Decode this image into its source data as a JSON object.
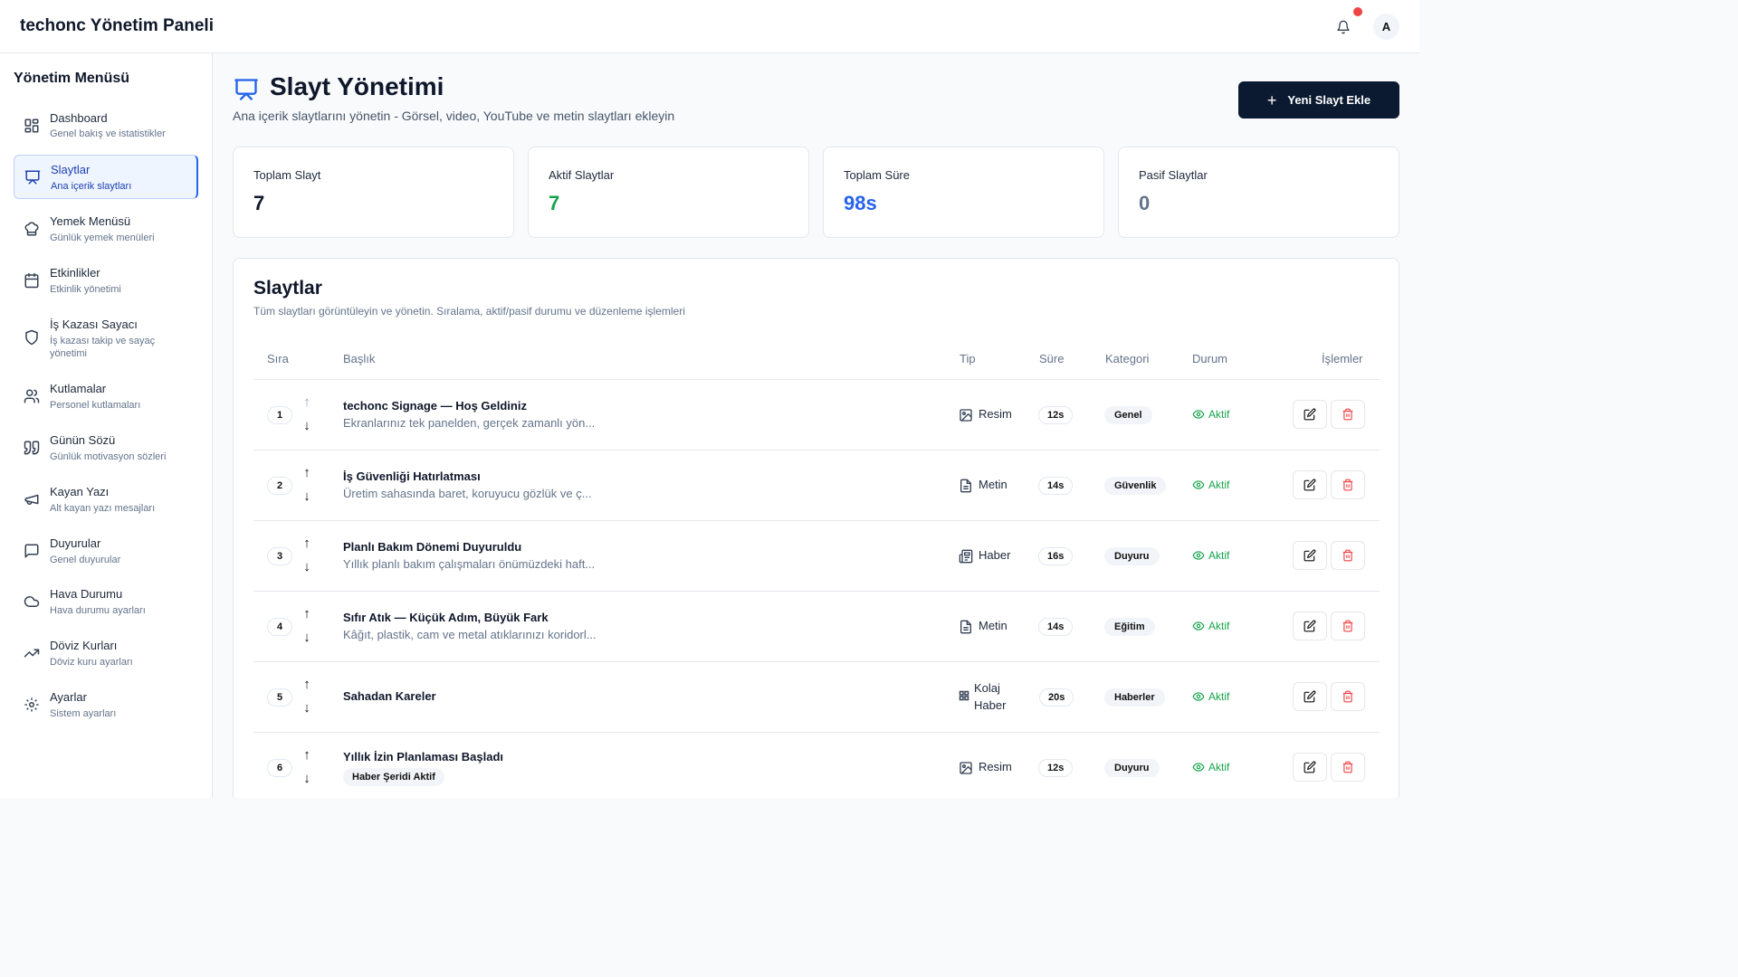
{
  "app": {
    "title": "techonc Yönetim Paneli",
    "avatar": "A"
  },
  "colors": {
    "primary": "#0b1a30",
    "accent": "#2563eb",
    "success": "#16a34a",
    "danger": "#ef4444"
  },
  "sidebar": {
    "title": "Yönetim Menüsü",
    "items": [
      {
        "label": "Dashboard",
        "sub": "Genel bakış ve istatistikler",
        "icon": "dashboard-icon"
      },
      {
        "label": "Slaytlar",
        "sub": "Ana içerik slaytları",
        "icon": "presentation-icon"
      },
      {
        "label": "Yemek Menüsü",
        "sub": "Günlük yemek menüleri",
        "icon": "chef-hat-icon"
      },
      {
        "label": "Etkinlikler",
        "sub": "Etkinlik yönetimi",
        "icon": "calendar-icon"
      },
      {
        "label": "İş Kazası Sayacı",
        "sub": "İş kazası takip ve sayaç yönetimi",
        "icon": "shield-icon"
      },
      {
        "label": "Kutlamalar",
        "sub": "Personel kutlamaları",
        "icon": "users-icon"
      },
      {
        "label": "Günün Sözü",
        "sub": "Günlük motivasyon sözleri",
        "icon": "quote-icon"
      },
      {
        "label": "Kayan Yazı",
        "sub": "Alt kayan yazı mesajları",
        "icon": "megaphone-icon"
      },
      {
        "label": "Duyurular",
        "sub": "Genel duyurular",
        "icon": "message-icon"
      },
      {
        "label": "Hava Durumu",
        "sub": "Hava durumu ayarları",
        "icon": "cloud-icon"
      },
      {
        "label": "Döviz Kurları",
        "sub": "Döviz kuru ayarları",
        "icon": "trending-up-icon"
      },
      {
        "label": "Ayarlar",
        "sub": "Sistem ayarları",
        "icon": "gear-icon"
      }
    ]
  },
  "page": {
    "title": "Slayt Yönetimi",
    "subtitle": "Ana içerik slaytlarını yönetin - Görsel, video, YouTube ve metin slaytları ekleyin",
    "add_button": "Yeni Slayt Ekle"
  },
  "stats": [
    {
      "label": "Toplam Slayt",
      "value": "7",
      "color": "#0f172a"
    },
    {
      "label": "Aktif Slaytlar",
      "value": "7",
      "color": "#16a34a"
    },
    {
      "label": "Toplam Süre",
      "value": "98s",
      "color": "#2563eb"
    },
    {
      "label": "Pasif Slaytlar",
      "value": "0",
      "color": "#64748b"
    }
  ],
  "table": {
    "title": "Slaytlar",
    "subtitle": "Tüm slaytları görüntüleyin ve yönetin. Sıralama, aktif/pasif durumu ve düzenleme işlemleri",
    "columns": {
      "order": "Sıra",
      "title": "Başlık",
      "type": "Tip",
      "duration": "Süre",
      "category": "Kategori",
      "status": "Durum",
      "actions": "İşlemler"
    },
    "rows": [
      {
        "order": "1",
        "title": "techonc Signage — Hoş Geldiniz",
        "desc": "Ekranlarınız tek panelden, gerçek zamanlı yön...",
        "type": "Resim",
        "type_icon": "image-icon",
        "duration": "12s",
        "category": "Genel",
        "status": "Aktif"
      },
      {
        "order": "2",
        "title": "İş Güvenliği Hatırlatması",
        "desc": "Üretim sahasında baret, koruyucu gözlük ve ç...",
        "type": "Metin",
        "type_icon": "file-text-icon",
        "duration": "14s",
        "category": "Güvenlik",
        "status": "Aktif"
      },
      {
        "order": "3",
        "title": "Planlı Bakım Dönemi Duyuruldu",
        "desc": "Yıllık planlı bakım çalışmaları önümüzdeki haft...",
        "type": "Haber",
        "type_icon": "newspaper-icon",
        "duration": "16s",
        "category": "Duyuru",
        "status": "Aktif"
      },
      {
        "order": "4",
        "title": "Sıfır Atık — Küçük Adım, Büyük Fark",
        "desc": "Kâğıt, plastik, cam ve metal atıklarınızı koridorl...",
        "type": "Metin",
        "type_icon": "file-text-icon",
        "duration": "14s",
        "category": "Eğitim",
        "status": "Aktif"
      },
      {
        "order": "5",
        "title": "Sahadan Kareler",
        "desc": "",
        "type_line1": "Kolaj",
        "type_line2": "Haber",
        "type_icon": "grid-icon",
        "duration": "20s",
        "category": "Haberler",
        "status": "Aktif"
      },
      {
        "order": "6",
        "title": "Yıllık İzin Planlaması Başladı",
        "badge": "Haber Şeridi Aktif",
        "type": "Resim",
        "type_icon": "image-icon",
        "duration": "12s",
        "category": "Duyuru",
        "status": "Aktif"
      }
    ]
  }
}
